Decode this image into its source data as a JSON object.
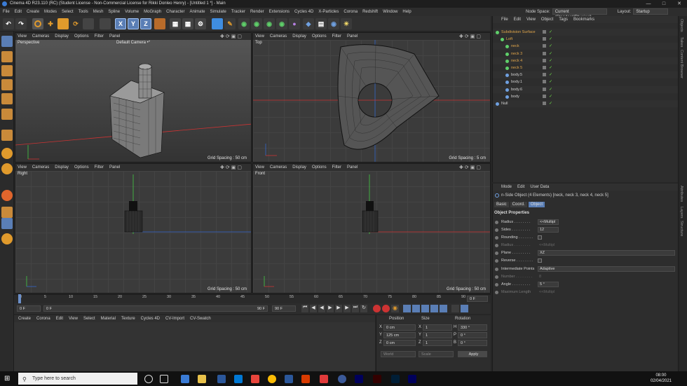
{
  "window": {
    "title": "Cinema 4D R23.110 (RC) (Student License - Non-Commercial License for Rikki Donleo Henry) - [Untitled 1 *] - Main"
  },
  "menu": [
    "File",
    "Edit",
    "Create",
    "Modes",
    "Select",
    "Tools",
    "Mesh",
    "Spline",
    "Volume",
    "MoGraph",
    "Character",
    "Animate",
    "Simulate",
    "Tracker",
    "Render",
    "Extensions",
    "Cycles 4D",
    "X-Particles",
    "Corona",
    "Redshift",
    "Window",
    "Help"
  ],
  "node_space": {
    "label": "Node Space:",
    "value": "Current (Standard/Physical)"
  },
  "layout": {
    "label": "Layout:",
    "value": "Startup"
  },
  "viewport_menu": [
    "View",
    "Cameras",
    "Display",
    "Options",
    "Filter",
    "Panel"
  ],
  "viewports": [
    {
      "name": "Perspective",
      "camera": "Default Camera •°",
      "grid": "Grid Spacing : 50 cm"
    },
    {
      "name": "Top",
      "camera": "",
      "grid": "Grid Spacing : 5 cm"
    },
    {
      "name": "Right",
      "camera": "",
      "grid": "Grid Spacing : 50 cm"
    },
    {
      "name": "Front",
      "camera": "",
      "grid": "Grid Spacing : 50 cm"
    }
  ],
  "timeline": {
    "ticks": [
      "0",
      "5",
      "10",
      "15",
      "20",
      "25",
      "30",
      "35",
      "40",
      "45",
      "50",
      "55",
      "60",
      "65",
      "70",
      "75",
      "80",
      "85",
      "90"
    ],
    "end_frame": "0 F"
  },
  "transport": {
    "start": "0 F",
    "current": "0 F",
    "range_end": "90 F",
    "end": "90 F"
  },
  "material_menu": [
    "Create",
    "Corona",
    "Edit",
    "View",
    "Select",
    "Material",
    "Texture",
    "Cycles 4D",
    "CV-Import",
    "CV-Swatch"
  ],
  "coordinates": {
    "headers": [
      "Position",
      "Size",
      "Rotation"
    ],
    "rows": [
      {
        "axis": "X",
        "pos": "0 cm",
        "size_axis": "X",
        "size": "1",
        "rot_axis": "H",
        "rot": "330 °"
      },
      {
        "axis": "Y",
        "pos": "125 cm",
        "size_axis": "Y",
        "size": "1",
        "rot_axis": "P",
        "rot": "0 °"
      },
      {
        "axis": "Z",
        "pos": "0 cm",
        "size_axis": "Z",
        "size": "1",
        "rot_axis": "B",
        "rot": "0 °"
      }
    ],
    "mode": "World",
    "size_mode": "Scale",
    "apply": "Apply"
  },
  "objects_menu": [
    "File",
    "Edit",
    "View",
    "Object",
    "Tags",
    "Bookmarks"
  ],
  "objects": [
    {
      "name": "Subdivision Surface",
      "indent": 0,
      "color": "#e0a54a"
    },
    {
      "name": "Loft",
      "indent": 1,
      "color": "#e0a54a"
    },
    {
      "name": "neck",
      "indent": 2,
      "color": "#e0a54a"
    },
    {
      "name": "neck 3",
      "indent": 2,
      "color": "#e0a54a"
    },
    {
      "name": "neck 4",
      "indent": 2,
      "color": "#e0a54a"
    },
    {
      "name": "neck 5",
      "indent": 2,
      "color": "#e0a54a"
    },
    {
      "name": "body.5",
      "indent": 2,
      "color": "#cfcfcf"
    },
    {
      "name": "body.1",
      "indent": 2,
      "color": "#cfcfcf"
    },
    {
      "name": "body.6",
      "indent": 2,
      "color": "#cfcfcf"
    },
    {
      "name": "body",
      "indent": 2,
      "color": "#cfcfcf"
    },
    {
      "name": "Null",
      "indent": 0,
      "color": "#cfcfcf"
    }
  ],
  "attributes": {
    "menu": [
      "Mode",
      "Edit",
      "User Data"
    ],
    "header": "n-Side Object (4 Elements) [neck, neck 3, neck 4, neck 5]",
    "tabs": [
      "Basic",
      "Coord.",
      "Object"
    ],
    "section": "Object Properties",
    "props": [
      {
        "label": "Radius . . . . . . . .",
        "value": "<<Multipl",
        "dim": false
      },
      {
        "label": "Sides . . . . . . . . .",
        "value": "12",
        "dim": false
      },
      {
        "label": "Rounding . . . . . . .",
        "value": "",
        "dim": false
      },
      {
        "label": "Radius . . . . . . . .",
        "value": "<<Multipl",
        "dim": true
      },
      {
        "label": "Plane . . . . . . . . .",
        "value": "XZ",
        "dim": false
      },
      {
        "label": "Reverse . . . . . . . .",
        "value": "",
        "dim": false
      },
      {
        "label": "Intermediate Points",
        "value": "Adaptive",
        "dim": false
      },
      {
        "label": "Number . . . . . . . .",
        "value": "8",
        "dim": true
      },
      {
        "label": "Angle . . . . . . . . .",
        "value": "5 °",
        "dim": false
      },
      {
        "label": "Maximum Length",
        "value": "<<Multipl",
        "dim": true
      }
    ]
  },
  "side_tabs": [
    "Objects",
    "Takes",
    "Content Browser",
    "Attributes",
    "Layers",
    "Structure"
  ],
  "taskbar": {
    "search_placeholder": "Type here to search",
    "time": "08:00",
    "date": "02/04/2021"
  }
}
